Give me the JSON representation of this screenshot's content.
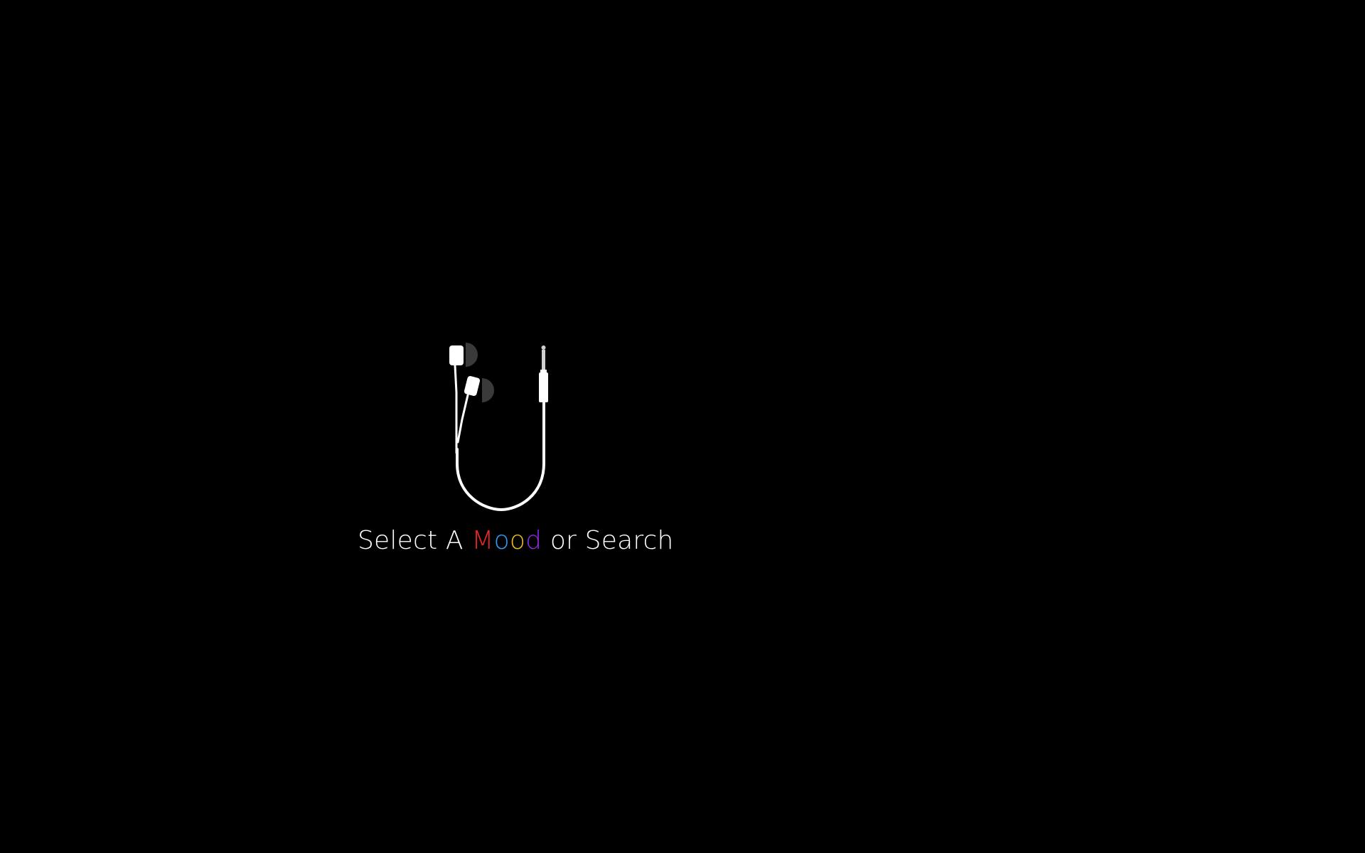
{
  "screen": {
    "background": "#000000"
  },
  "illustration": {
    "icon": "earphones-icon",
    "cable_color": "#ffffff",
    "earbud_shade_color": "#3a3a3a"
  },
  "prompt": {
    "before": "Select A ",
    "mood_letters": [
      {
        "char": "M",
        "color": "#e8262b"
      },
      {
        "char": "o",
        "color": "#2f9ef0"
      },
      {
        "char": "o",
        "color": "#e6b82a"
      },
      {
        "char": "d",
        "color": "#8a2be2"
      }
    ],
    "after": " or Search"
  }
}
